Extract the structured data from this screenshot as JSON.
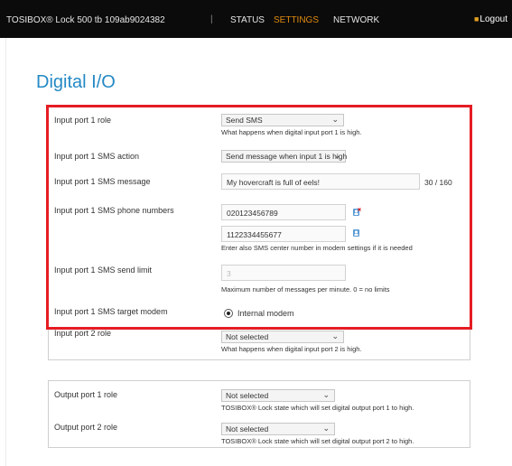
{
  "header": {
    "device": "TOSIBOX® Lock 500 tb 109ab9024382",
    "separator": "|",
    "nav": {
      "status": "STATUS",
      "settings": "SETTINGS",
      "network": "NETWORK"
    },
    "logout": "Logout",
    "active_color": "#e08a10"
  },
  "page": {
    "title": "Digital I/O",
    "title_color": "#2489c5"
  },
  "highlight_color": "#e51c23",
  "inputs_section": {
    "port1_role": {
      "label": "Input port 1 role",
      "value": "Send SMS",
      "help": "What happens when digital input port 1 is high."
    },
    "port1_sms_action": {
      "label": "Input port 1 SMS action",
      "value": "Send message when input 1 is high"
    },
    "port1_sms_message": {
      "label": "Input port 1 SMS message",
      "value": "My hovercraft is full of eels!",
      "counter": "30 / 160"
    },
    "port1_sms_phone_numbers": {
      "label": "Input port 1 SMS phone numbers",
      "numbers": [
        "020123456789",
        "1122334455677"
      ],
      "help": "Enter also SMS center number in modem settings if it is needed"
    },
    "port1_sms_send_limit": {
      "label": "Input port 1 SMS send limit",
      "value": "3",
      "help": "Maximum number of messages per minute. 0 = no limits"
    },
    "port1_sms_target_modem": {
      "label": "Input port 1 SMS target modem",
      "option": "Internal modem"
    },
    "port2_role": {
      "label": "Input port 2 role",
      "value": "Not selected",
      "help": "What happens when digital input port 2 is high."
    }
  },
  "outputs_section": {
    "port1_role": {
      "label": "Output port 1 role",
      "value": "Not selected",
      "help": "TOSIBOX® Lock state which will set digital output port 1 to high."
    },
    "port2_role": {
      "label": "Output port 2 role",
      "value": "Not selected",
      "help": "TOSIBOX® Lock state which will set digital output port 2 to high."
    }
  }
}
